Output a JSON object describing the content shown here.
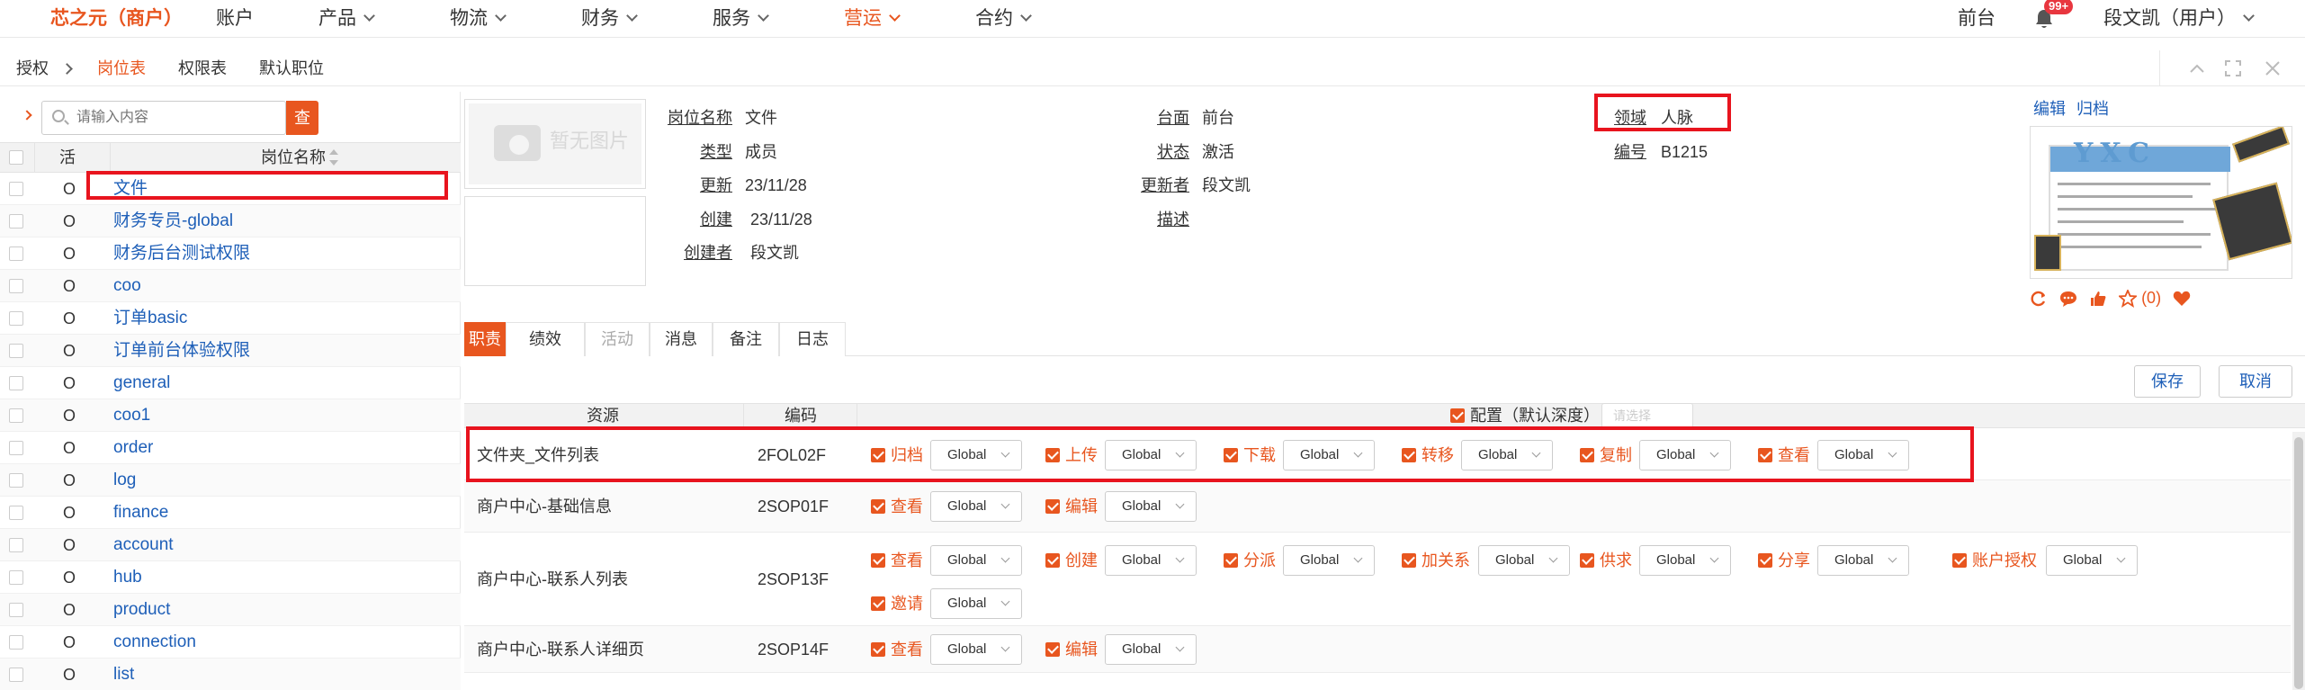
{
  "nav": {
    "brand": "芯之元（商户）",
    "items": [
      {
        "label": "账户",
        "dropdown": false
      },
      {
        "label": "产品",
        "dropdown": true
      },
      {
        "label": "物流",
        "dropdown": true
      },
      {
        "label": "财务",
        "dropdown": true
      },
      {
        "label": "服务",
        "dropdown": true
      },
      {
        "label": "营运",
        "dropdown": true,
        "active": true
      },
      {
        "label": "合约",
        "dropdown": true
      }
    ],
    "frontdesk": "前台",
    "badge": "99+",
    "user": "段文凯（用户）",
    "accent": "#e8561f"
  },
  "breadcrumb": {
    "root": "授权",
    "tabs": [
      "岗位表",
      "权限表",
      "默认职位"
    ]
  },
  "left": {
    "search_placeholder": "请输入内容",
    "search_button": "查",
    "col_active": "活",
    "col_name": "岗位名称",
    "rows": [
      {
        "active": "O",
        "name": "文件"
      },
      {
        "active": "O",
        "name": "财务专员-global"
      },
      {
        "active": "O",
        "name": "财务后台测试权限"
      },
      {
        "active": "O",
        "name": "coo"
      },
      {
        "active": "O",
        "name": "订单basic"
      },
      {
        "active": "O",
        "name": "订单前台体验权限"
      },
      {
        "active": "O",
        "name": "general"
      },
      {
        "active": "O",
        "name": "coo1"
      },
      {
        "active": "O",
        "name": "order"
      },
      {
        "active": "O",
        "name": "log"
      },
      {
        "active": "O",
        "name": "finance"
      },
      {
        "active": "O",
        "name": "account"
      },
      {
        "active": "O",
        "name": "hub"
      },
      {
        "active": "O",
        "name": "product"
      },
      {
        "active": "O",
        "name": "connection"
      },
      {
        "active": "O",
        "name": "list"
      }
    ]
  },
  "detail": {
    "no_image": "暂无图片",
    "col1": [
      {
        "label": "岗位名称",
        "value": "文件"
      },
      {
        "label": "类型",
        "value": "成员"
      },
      {
        "label": "更新",
        "value": "23/11/28"
      },
      {
        "label": "创建",
        "value": "23/11/28"
      },
      {
        "label": "创建者",
        "value": "段文凯"
      }
    ],
    "col2": [
      {
        "label": "台面",
        "value": "前台"
      },
      {
        "label": "状态",
        "value": "激活"
      },
      {
        "label": "更新者",
        "value": "段文凯"
      },
      {
        "label": "描述",
        "value": ""
      }
    ],
    "col3": [
      {
        "label": "领域",
        "value": "人脉"
      },
      {
        "label": "编号",
        "value": "B1215"
      }
    ],
    "edit": "编辑",
    "archive": "归档",
    "product_logo": "YXC",
    "favorite_count": "(0)"
  },
  "tabs": [
    {
      "label": "职责",
      "state": "active"
    },
    {
      "label": "绩效",
      "state": "normal"
    },
    {
      "label": "活动",
      "state": "disabled"
    },
    {
      "label": "消息",
      "state": "normal"
    },
    {
      "label": "备注",
      "state": "normal"
    },
    {
      "label": "日志",
      "state": "normal"
    }
  ],
  "buttons": {
    "save": "保存",
    "cancel": "取消"
  },
  "grid": {
    "col_resource": "资源",
    "col_code": "编码",
    "col_config": "配置（默认深度）",
    "select_placeholder": "请选择",
    "rows": [
      {
        "resource": "文件夹_文件列表",
        "code": "2FOL02F",
        "lines": [
          [
            {
              "label": "归档",
              "depth": "Global"
            },
            {
              "label": "上传",
              "depth": "Global"
            },
            {
              "label": "下载",
              "depth": "Global"
            },
            {
              "label": "转移",
              "depth": "Global"
            },
            {
              "label": "复制",
              "depth": "Global"
            },
            {
              "label": "查看",
              "depth": "Global"
            }
          ]
        ]
      },
      {
        "resource": "商户中心-基础信息",
        "code": "2SOP01F",
        "lines": [
          [
            {
              "label": "查看",
              "depth": "Global"
            },
            {
              "label": "编辑",
              "depth": "Global"
            }
          ]
        ]
      },
      {
        "resource": "商户中心-联系人列表",
        "code": "2SOP13F",
        "lines": [
          [
            {
              "label": "查看",
              "depth": "Global"
            },
            {
              "label": "创建",
              "depth": "Global"
            },
            {
              "label": "分派",
              "depth": "Global"
            },
            {
              "label": "加关系",
              "depth": "Global"
            },
            {
              "label": "供求",
              "depth": "Global"
            },
            {
              "label": "分享",
              "depth": "Global"
            },
            {
              "label": "账户授权",
              "depth": "Global"
            }
          ],
          [
            {
              "label": "邀请",
              "depth": "Global"
            }
          ]
        ]
      },
      {
        "resource": "商户中心-联系人详细页",
        "code": "2SOP14F",
        "lines": [
          [
            {
              "label": "查看",
              "depth": "Global"
            },
            {
              "label": "编辑",
              "depth": "Global"
            }
          ]
        ]
      }
    ]
  }
}
